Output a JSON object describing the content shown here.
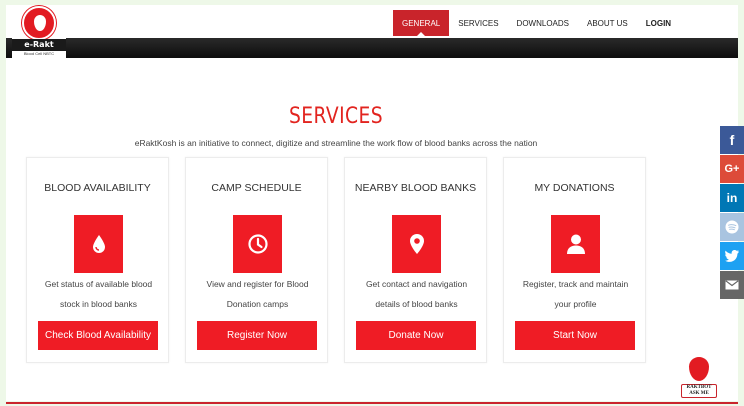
{
  "logo": {
    "brand": "e-Rakt Kosh",
    "tagline": "Blood Cell NBTC"
  },
  "nav": {
    "items": [
      {
        "label": "GENERAL",
        "active": true
      },
      {
        "label": "SERVICES",
        "active": false
      },
      {
        "label": "DOWNLOADS",
        "active": false
      },
      {
        "label": "ABOUT US",
        "active": false
      },
      {
        "label": "LOGIN",
        "active": false
      }
    ]
  },
  "section": {
    "title": "SERVICES",
    "subtitle": "eRaktKosh is an initiative to connect, digitize and streamline the work flow of blood banks across the nation"
  },
  "cards": [
    {
      "title": "BLOOD AVAILABILITY",
      "icon": "blood-drop-icon",
      "desc_line1": "Get status of available blood",
      "desc_line2": "stock in blood banks",
      "button": "Check Blood Availability"
    },
    {
      "title": "CAMP SCHEDULE",
      "icon": "clock-icon",
      "desc_line1": "View and register for Blood",
      "desc_line2": "Donation camps",
      "button": "Register Now"
    },
    {
      "title": "NEARBY BLOOD BANKS",
      "icon": "map-pin-icon",
      "desc_line1": "Get contact and navigation",
      "desc_line2": "details of blood banks",
      "button": "Donate Now"
    },
    {
      "title": "MY DONATIONS",
      "icon": "user-icon",
      "desc_line1": "Register, track and maintain",
      "desc_line2": "your profile",
      "button": "Start Now"
    }
  ],
  "social": [
    {
      "name": "facebook-icon",
      "glyph": "f",
      "color": "#3b5998"
    },
    {
      "name": "google-plus-icon",
      "glyph": "G+",
      "color": "#dd4b39"
    },
    {
      "name": "linkedin-icon",
      "glyph": "in",
      "color": "#0077b5"
    },
    {
      "name": "spotify-icon",
      "glyph": "≋",
      "color": "#a9c4e0"
    },
    {
      "name": "twitter-icon",
      "glyph": "🐦",
      "color": "#1da1f2"
    },
    {
      "name": "email-icon",
      "glyph": "✉",
      "color": "#666666"
    }
  ],
  "chatbot": {
    "label_line1": "RAKTBOT",
    "label_line2": "ASK ME"
  },
  "colors": {
    "accent": "#ef1c25",
    "nav_active": "#c9242b"
  }
}
